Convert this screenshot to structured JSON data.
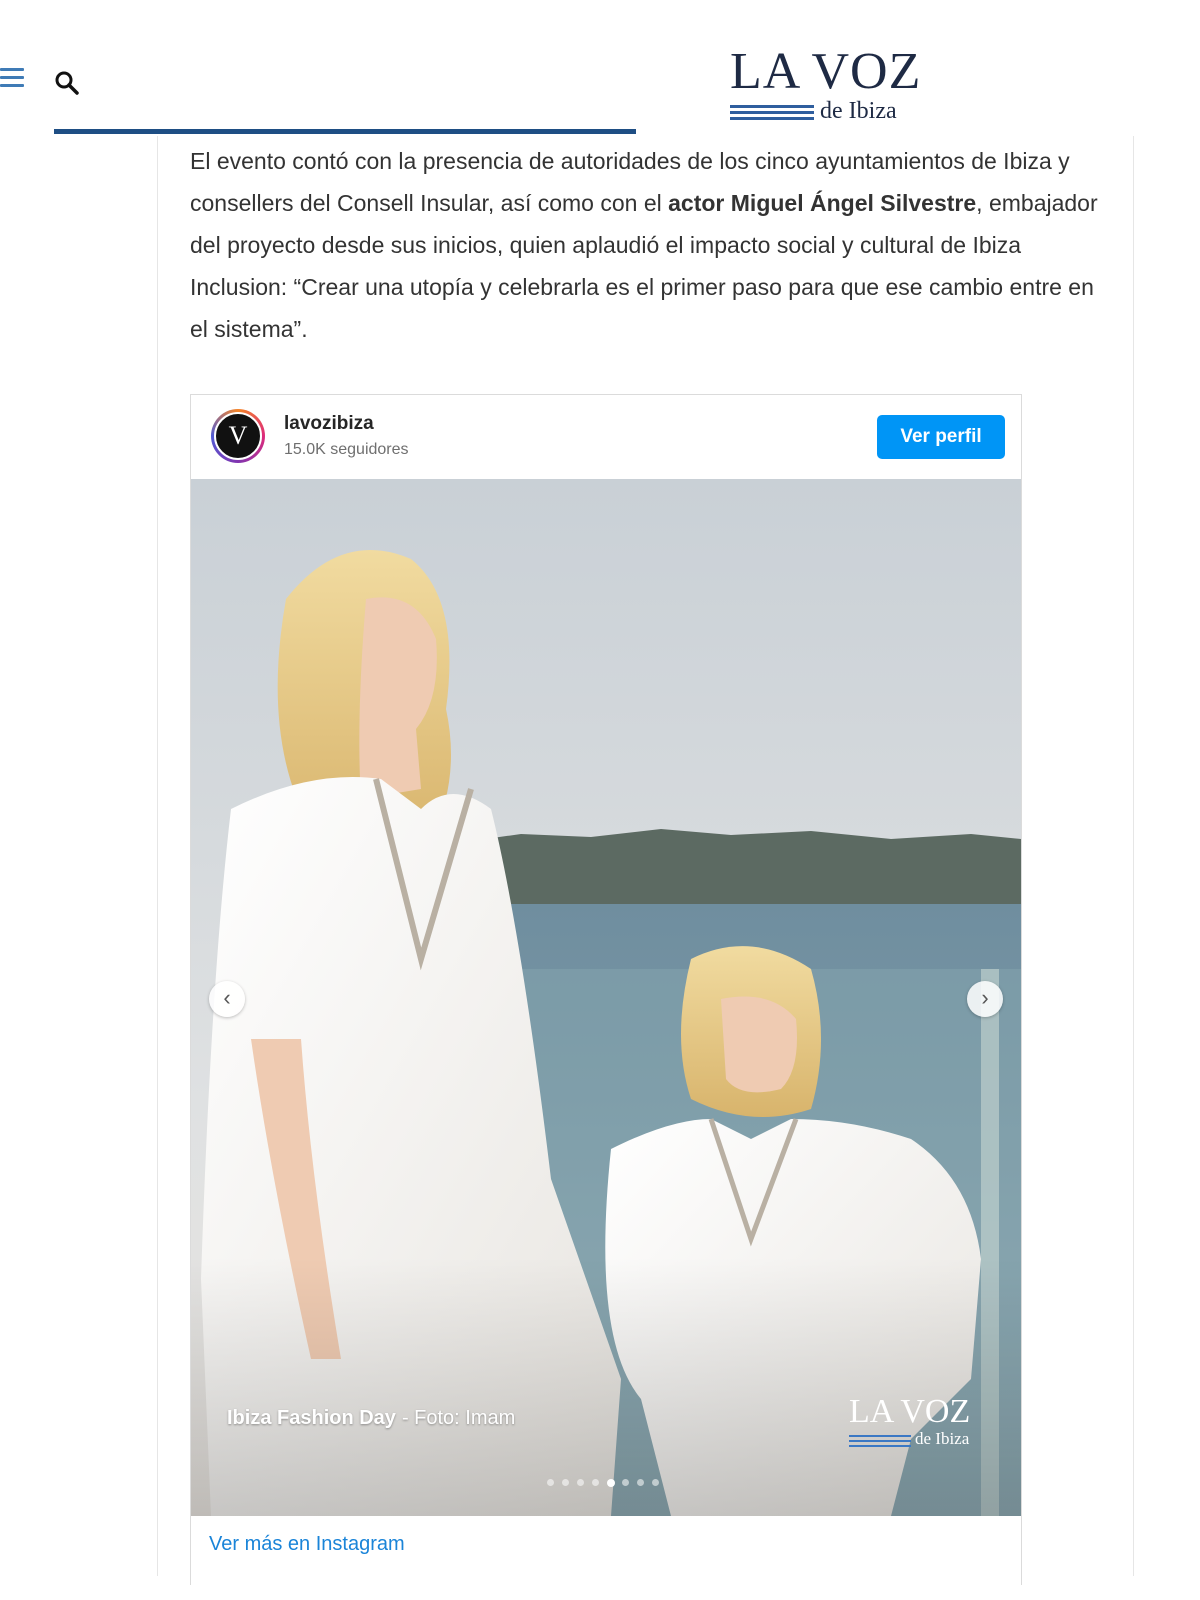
{
  "header": {
    "menu_icon": "hamburger-menu-icon",
    "search_icon": "search-icon",
    "logo": {
      "main": "LA VOZ",
      "sub": "de Ibiza"
    }
  },
  "article": {
    "paragraph_start": "El evento contó con la presencia de autoridades de los cinco ayuntamientos de Ibiza y consellers del Consell Insular, así como con el ",
    "paragraph_bold": "actor Miguel Ángel Silvestre",
    "paragraph_end": ", embajador del proyecto desde sus inicios, quien aplaudió el impacto social y cultural de Ibiza Inclusion: “Crear una utopía y celebrarla es el primer paso para que ese cambio entre en el sistema”."
  },
  "instagram": {
    "avatar_letter": "V",
    "username": "lavozibiza",
    "followers": "15.0K seguidores",
    "profile_button": "Ver perfil",
    "caption_title": "Ibiza Fashion Day",
    "caption_credit": "- Foto: Imam",
    "watermark": {
      "main": "LA VOZ",
      "sub": "de Ibiza"
    },
    "carousel": {
      "total_slides": 8,
      "active_index": 4
    },
    "prev_arrow": "‹",
    "next_arrow": "›",
    "more_link": "Ver más en Instagram"
  },
  "colors": {
    "accent_blue": "#1e4e84",
    "instagram_button": "#0095f6",
    "link_blue": "#1a84d8"
  }
}
